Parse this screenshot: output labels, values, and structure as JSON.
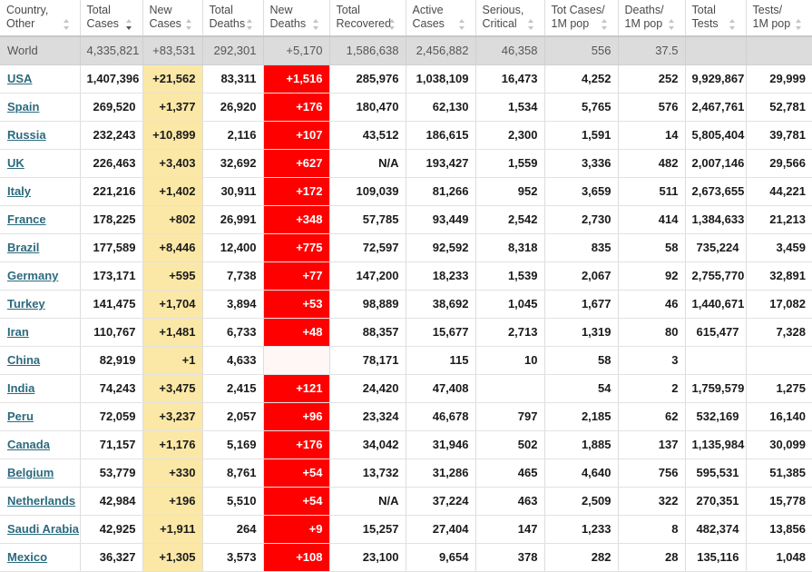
{
  "table": {
    "columns": [
      {
        "label_line1": "Country,",
        "label_line2": "Other",
        "sort_active": false,
        "key": "country"
      },
      {
        "label_line1": "Total",
        "label_line2": "Cases",
        "sort_active": true,
        "key": "total_cases"
      },
      {
        "label_line1": "New",
        "label_line2": "Cases",
        "sort_active": false,
        "key": "new_cases"
      },
      {
        "label_line1": "Total",
        "label_line2": "Deaths",
        "sort_active": false,
        "key": "total_deaths"
      },
      {
        "label_line1": "New",
        "label_line2": "Deaths",
        "sort_active": false,
        "key": "new_deaths"
      },
      {
        "label_line1": "Total",
        "label_line2": "Recovered",
        "sort_active": false,
        "key": "total_recovered"
      },
      {
        "label_line1": "Active",
        "label_line2": "Cases",
        "sort_active": false,
        "key": "active_cases"
      },
      {
        "label_line1": "Serious,",
        "label_line2": "Critical",
        "sort_active": false,
        "key": "serious_critical"
      },
      {
        "label_line1": "Tot Cases/",
        "label_line2": "1M pop",
        "sort_active": false,
        "key": "tot_cases_per_1m"
      },
      {
        "label_line1": "Deaths/",
        "label_line2": "1M pop",
        "sort_active": false,
        "key": "deaths_per_1m"
      },
      {
        "label_line1": "Total",
        "label_line2": "Tests",
        "sort_active": false,
        "key": "total_tests"
      },
      {
        "label_line1": "Tests/",
        "label_line2": "1M pop",
        "sort_active": false,
        "key": "tests_per_1m"
      }
    ],
    "world_row": {
      "country": "World",
      "total_cases": "4,335,821",
      "new_cases": "+83,531",
      "total_deaths": "292,301",
      "new_deaths": "+5,170",
      "total_recovered": "1,586,638",
      "active_cases": "2,456,882",
      "serious_critical": "46,358",
      "tot_cases_per_1m": "556",
      "deaths_per_1m": "37.5",
      "total_tests": "",
      "tests_per_1m": ""
    },
    "rows": [
      {
        "country": "USA",
        "total_cases": "1,407,396",
        "new_cases": "+21,562",
        "total_deaths": "83,311",
        "new_deaths": "+1,516",
        "total_recovered": "285,976",
        "active_cases": "1,038,109",
        "serious_critical": "16,473",
        "tot_cases_per_1m": "4,252",
        "deaths_per_1m": "252",
        "total_tests": "9,929,867",
        "tests_per_1m": "29,999"
      },
      {
        "country": "Spain",
        "total_cases": "269,520",
        "new_cases": "+1,377",
        "total_deaths": "26,920",
        "new_deaths": "+176",
        "total_recovered": "180,470",
        "active_cases": "62,130",
        "serious_critical": "1,534",
        "tot_cases_per_1m": "5,765",
        "deaths_per_1m": "576",
        "total_tests": "2,467,761",
        "tests_per_1m": "52,781"
      },
      {
        "country": "Russia",
        "total_cases": "232,243",
        "new_cases": "+10,899",
        "total_deaths": "2,116",
        "new_deaths": "+107",
        "total_recovered": "43,512",
        "active_cases": "186,615",
        "serious_critical": "2,300",
        "tot_cases_per_1m": "1,591",
        "deaths_per_1m": "14",
        "total_tests": "5,805,404",
        "tests_per_1m": "39,781"
      },
      {
        "country": "UK",
        "total_cases": "226,463",
        "new_cases": "+3,403",
        "total_deaths": "32,692",
        "new_deaths": "+627",
        "total_recovered": "N/A",
        "active_cases": "193,427",
        "serious_critical": "1,559",
        "tot_cases_per_1m": "3,336",
        "deaths_per_1m": "482",
        "total_tests": "2,007,146",
        "tests_per_1m": "29,566"
      },
      {
        "country": "Italy",
        "total_cases": "221,216",
        "new_cases": "+1,402",
        "total_deaths": "30,911",
        "new_deaths": "+172",
        "total_recovered": "109,039",
        "active_cases": "81,266",
        "serious_critical": "952",
        "tot_cases_per_1m": "3,659",
        "deaths_per_1m": "511",
        "total_tests": "2,673,655",
        "tests_per_1m": "44,221"
      },
      {
        "country": "France",
        "total_cases": "178,225",
        "new_cases": "+802",
        "total_deaths": "26,991",
        "new_deaths": "+348",
        "total_recovered": "57,785",
        "active_cases": "93,449",
        "serious_critical": "2,542",
        "tot_cases_per_1m": "2,730",
        "deaths_per_1m": "414",
        "total_tests": "1,384,633",
        "tests_per_1m": "21,213"
      },
      {
        "country": "Brazil",
        "total_cases": "177,589",
        "new_cases": "+8,446",
        "total_deaths": "12,400",
        "new_deaths": "+775",
        "total_recovered": "72,597",
        "active_cases": "92,592",
        "serious_critical": "8,318",
        "tot_cases_per_1m": "835",
        "deaths_per_1m": "58",
        "total_tests": "735,224",
        "tests_per_1m": "3,459"
      },
      {
        "country": "Germany",
        "total_cases": "173,171",
        "new_cases": "+595",
        "total_deaths": "7,738",
        "new_deaths": "+77",
        "total_recovered": "147,200",
        "active_cases": "18,233",
        "serious_critical": "1,539",
        "tot_cases_per_1m": "2,067",
        "deaths_per_1m": "92",
        "total_tests": "2,755,770",
        "tests_per_1m": "32,891"
      },
      {
        "country": "Turkey",
        "total_cases": "141,475",
        "new_cases": "+1,704",
        "total_deaths": "3,894",
        "new_deaths": "+53",
        "total_recovered": "98,889",
        "active_cases": "38,692",
        "serious_critical": "1,045",
        "tot_cases_per_1m": "1,677",
        "deaths_per_1m": "46",
        "total_tests": "1,440,671",
        "tests_per_1m": "17,082"
      },
      {
        "country": "Iran",
        "total_cases": "110,767",
        "new_cases": "+1,481",
        "total_deaths": "6,733",
        "new_deaths": "+48",
        "total_recovered": "88,357",
        "active_cases": "15,677",
        "serious_critical": "2,713",
        "tot_cases_per_1m": "1,319",
        "deaths_per_1m": "80",
        "total_tests": "615,477",
        "tests_per_1m": "7,328"
      },
      {
        "country": "China",
        "total_cases": "82,919",
        "new_cases": "+1",
        "total_deaths": "4,633",
        "new_deaths": "",
        "total_recovered": "78,171",
        "active_cases": "115",
        "serious_critical": "10",
        "tot_cases_per_1m": "58",
        "deaths_per_1m": "3",
        "total_tests": "",
        "tests_per_1m": ""
      },
      {
        "country": "India",
        "total_cases": "74,243",
        "new_cases": "+3,475",
        "total_deaths": "2,415",
        "new_deaths": "+121",
        "total_recovered": "24,420",
        "active_cases": "47,408",
        "serious_critical": "",
        "tot_cases_per_1m": "54",
        "deaths_per_1m": "2",
        "total_tests": "1,759,579",
        "tests_per_1m": "1,275"
      },
      {
        "country": "Peru",
        "total_cases": "72,059",
        "new_cases": "+3,237",
        "total_deaths": "2,057",
        "new_deaths": "+96",
        "total_recovered": "23,324",
        "active_cases": "46,678",
        "serious_critical": "797",
        "tot_cases_per_1m": "2,185",
        "deaths_per_1m": "62",
        "total_tests": "532,169",
        "tests_per_1m": "16,140"
      },
      {
        "country": "Canada",
        "total_cases": "71,157",
        "new_cases": "+1,176",
        "total_deaths": "5,169",
        "new_deaths": "+176",
        "total_recovered": "34,042",
        "active_cases": "31,946",
        "serious_critical": "502",
        "tot_cases_per_1m": "1,885",
        "deaths_per_1m": "137",
        "total_tests": "1,135,984",
        "tests_per_1m": "30,099"
      },
      {
        "country": "Belgium",
        "total_cases": "53,779",
        "new_cases": "+330",
        "total_deaths": "8,761",
        "new_deaths": "+54",
        "total_recovered": "13,732",
        "active_cases": "31,286",
        "serious_critical": "465",
        "tot_cases_per_1m": "4,640",
        "deaths_per_1m": "756",
        "total_tests": "595,531",
        "tests_per_1m": "51,385"
      },
      {
        "country": "Netherlands",
        "total_cases": "42,984",
        "new_cases": "+196",
        "total_deaths": "5,510",
        "new_deaths": "+54",
        "total_recovered": "N/A",
        "active_cases": "37,224",
        "serious_critical": "463",
        "tot_cases_per_1m": "2,509",
        "deaths_per_1m": "322",
        "total_tests": "270,351",
        "tests_per_1m": "15,778"
      },
      {
        "country": "Saudi Arabia",
        "total_cases": "42,925",
        "new_cases": "+1,911",
        "total_deaths": "264",
        "new_deaths": "+9",
        "total_recovered": "15,257",
        "active_cases": "27,404",
        "serious_critical": "147",
        "tot_cases_per_1m": "1,233",
        "deaths_per_1m": "8",
        "total_tests": "482,374",
        "tests_per_1m": "13,856"
      },
      {
        "country": "Mexico",
        "total_cases": "36,327",
        "new_cases": "+1,305",
        "total_deaths": "3,573",
        "new_deaths": "+108",
        "total_recovered": "23,100",
        "active_cases": "9,654",
        "serious_critical": "378",
        "tot_cases_per_1m": "282",
        "deaths_per_1m": "28",
        "total_tests": "135,116",
        "tests_per_1m": "1,048"
      }
    ]
  },
  "colors": {
    "new_cases_highlight": "#fbe8a6",
    "new_deaths_highlight": "#ff0000",
    "world_row_bg": "#dcdcdc",
    "country_link": "#2b6a7e"
  }
}
